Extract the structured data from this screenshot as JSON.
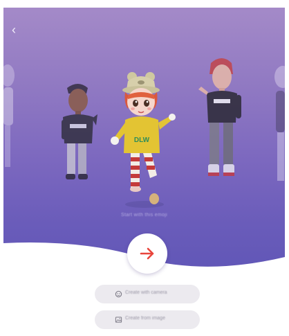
{
  "header": {
    "back_icon": "chevron-left-icon"
  },
  "hero": {
    "caption": "Start with this emoji"
  },
  "next": {
    "icon": "arrow-right-icon",
    "accent": "#e8453c"
  },
  "actions": [
    {
      "label": "Create with camera",
      "icon": "emoji-face-icon"
    },
    {
      "label": "Create from image",
      "icon": "image-icon"
    }
  ],
  "colors": {
    "gradient_top": "#a48ac8",
    "gradient_bottom": "#5e55b6",
    "pill_bg": "#eceaef"
  }
}
